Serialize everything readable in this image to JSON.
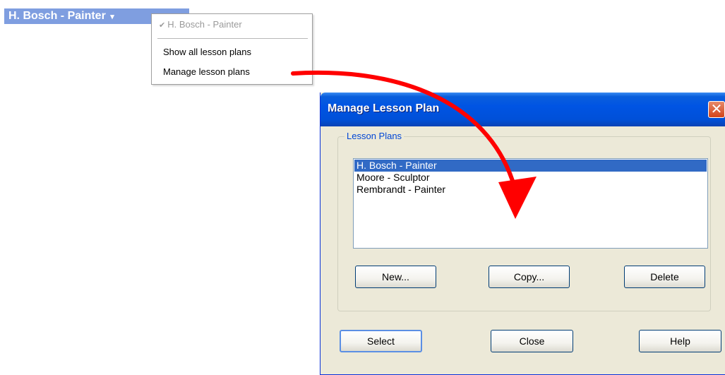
{
  "selector": {
    "label": "H. Bosch - Painter",
    "chevron": "▾"
  },
  "menu": {
    "checked_item": "H. Bosch - Painter",
    "items": [
      "Show all lesson plans",
      "Manage lesson plans"
    ]
  },
  "dialog": {
    "title": "Manage Lesson Plan",
    "close_glyph": "✕",
    "group_label": "Lesson Plans",
    "list": [
      "H. Bosch - Painter",
      "Moore - Sculptor",
      "Rembrandt - Painter"
    ],
    "selected_index": 0,
    "buttons": {
      "new": "New...",
      "copy": "Copy...",
      "delete": "Delete"
    },
    "footer": {
      "select": "Select",
      "close": "Close",
      "help": "Help"
    }
  },
  "colors": {
    "annotation_arrow": "#ff0000",
    "selection": "#316ac5",
    "titlebar": "#0054e3"
  },
  "icons": {
    "menu_check": "checkmark-icon",
    "title_close": "close-icon"
  }
}
